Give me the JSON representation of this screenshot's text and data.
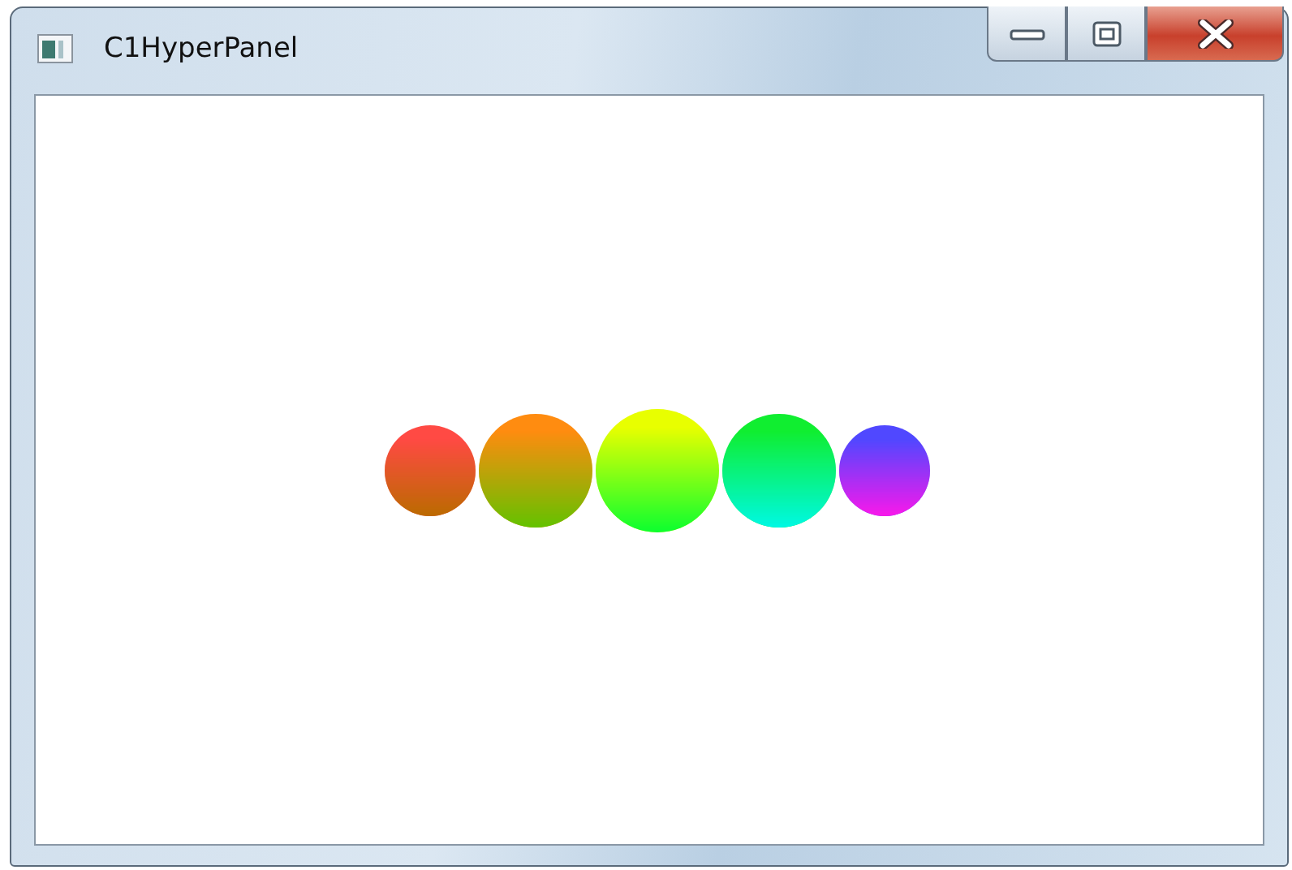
{
  "window": {
    "title": "C1HyperPanel"
  },
  "circles": [
    {
      "color": "#ff4a44"
    },
    {
      "color": "#ff8c10"
    },
    {
      "color": "#e8ff00"
    },
    {
      "color": "#10ee30"
    },
    {
      "color": "#5048ff"
    }
  ]
}
